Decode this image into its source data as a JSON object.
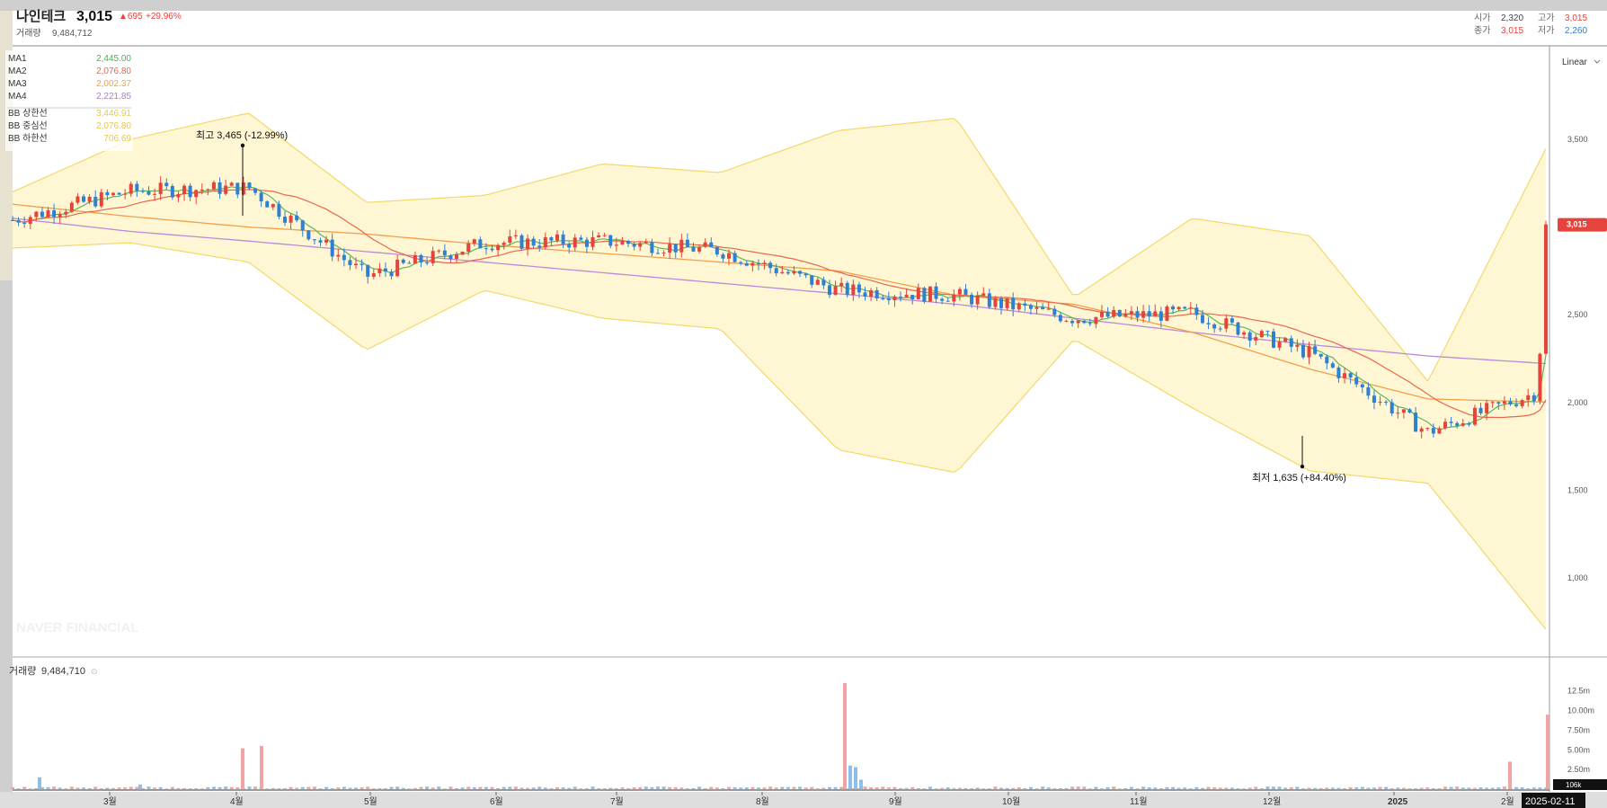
{
  "header": {
    "name": "나인테크",
    "price": "3,015",
    "change": "▲695",
    "change_pct": "+29.96%",
    "volume_label": "거래량",
    "volume_value": "9,484,712",
    "open_label": "시가",
    "open_value": "2,320",
    "high_label": "고가",
    "high_value": "3,015",
    "close_label": "종가",
    "close_value": "3,015",
    "low_label": "저가",
    "low_value": "2,260"
  },
  "legend": [
    {
      "label": "MA1",
      "value": "2,445.00",
      "color": "#4caf50"
    },
    {
      "label": "MA2",
      "value": "2,076.80",
      "color": "#e8684a"
    },
    {
      "label": "MA3",
      "value": "2,002.37",
      "color": "#f0a04b"
    },
    {
      "label": "MA4",
      "value": "2,221.85",
      "color": "#b279d4"
    },
    {
      "label": "BB 상한선",
      "value": "3,446.91",
      "color": "#e6c84a"
    },
    {
      "label": "BB 중심선",
      "value": "2,076.80",
      "color": "#e6c84a"
    },
    {
      "label": "BB 하한선",
      "value": "706.69",
      "color": "#e6c84a"
    }
  ],
  "scale_mode": "Linear",
  "watermark": "NAVER FINANCIAL",
  "colors": {
    "up": "#e5433b",
    "down": "#2f7fd3",
    "vol_up": "#f2a3a3",
    "vol_down": "#8fbfe8",
    "band": "#fff6d4",
    "band_line": "#f3d86a"
  },
  "chart_data": [
    {
      "type": "candlestick",
      "title": "",
      "xlabel": "",
      "ylabel": "",
      "ylim": [
        600,
        3700
      ],
      "yticks": [
        1000,
        1500,
        2000,
        2500,
        3000,
        3500
      ],
      "ytick_labels": [
        "1,000",
        "1,500",
        "2,000",
        "2,500",
        "3,000",
        "3,500"
      ],
      "x_tick_labels": [
        "3월",
        "4월",
        "5월",
        "6월",
        "7월",
        "8월",
        "9월",
        "10월",
        "11월",
        "12월",
        "2025",
        "2월"
      ],
      "current_price_label": "3,015",
      "current_price": 3015,
      "date_label": "2025-02-11",
      "annotations": [
        {
          "text": "최고 3,465 (-12.99%)",
          "value": 3465
        },
        {
          "text": "최저 1,635 (+84.40%)",
          "value": 1635
        }
      ],
      "series": [
        {
          "name": "MA4",
          "values": [
            3050,
            2975,
            2920,
            2860,
            2800,
            2740,
            2680,
            2620,
            2560,
            2480,
            2400,
            2330,
            2265,
            2221.85
          ]
        },
        {
          "name": "MA3",
          "values": [
            3130,
            3060,
            3000,
            2960,
            2900,
            2850,
            2800,
            2750,
            2610,
            2560,
            2400,
            2190,
            2020,
            2002.37
          ]
        },
        {
          "name": "BB 상한선",
          "values": [
            3200,
            3500,
            3650,
            3140,
            3180,
            3360,
            3310,
            3550,
            3620,
            2600,
            3050,
            2950,
            2120,
            3446.91
          ]
        },
        {
          "name": "BB 하한선",
          "values": [
            2880,
            2910,
            2800,
            2300,
            2640,
            2480,
            2420,
            1730,
            1600,
            2360,
            1970,
            1610,
            1540,
            706.69
          ]
        }
      ]
    },
    {
      "type": "bar",
      "title": "",
      "series_label": "거래량",
      "series_value": "9,484,710",
      "ylim": [
        0,
        15000000
      ],
      "yticks": [
        2500000,
        5000000,
        7500000,
        10000000,
        12500000
      ],
      "ytick_labels": [
        "2.50m",
        "5.00m",
        "7.50m",
        "10.00m",
        "12.5m"
      ],
      "last_bar_label": "106k",
      "peaks": [
        {
          "month": "4월",
          "value": 5200000
        },
        {
          "month": "4월",
          "value": 5500000
        },
        {
          "month": "8월",
          "value": 13500000
        },
        {
          "month": "2월",
          "value": 3500000
        },
        {
          "month": "2월",
          "value": 9484710
        }
      ]
    }
  ]
}
